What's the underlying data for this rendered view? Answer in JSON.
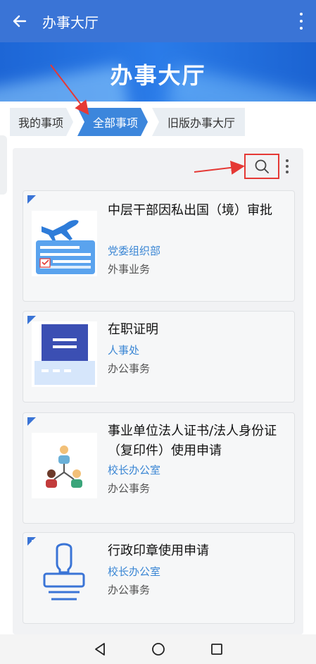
{
  "appbar": {
    "title": "办事大厅",
    "back_icon": "arrow-left-icon",
    "menu_icon": "more-vert-icon"
  },
  "banner": {
    "title": "办事大厅"
  },
  "tabs": [
    {
      "label": "我的事项",
      "active": false
    },
    {
      "label": "全部事项",
      "active": true
    },
    {
      "label": "旧版办事大厅",
      "active": false
    }
  ],
  "toolbar": {
    "search_icon": "search-icon",
    "more_icon": "more-vert-icon",
    "highlight_color": "#e53935"
  },
  "cards": [
    {
      "name": "中层干部因私出国（境）审批",
      "dept": "党委组织部",
      "category": "外事业务",
      "icon": "airplane-form-icon"
    },
    {
      "name": "在职证明",
      "dept": "人事处",
      "category": "办公事务",
      "icon": "document-certificate-icon"
    },
    {
      "name": "事业单位法人证书/法人身份证（复印件）使用申请",
      "dept": "校长办公室",
      "category": "办公事务",
      "icon": "people-network-icon"
    },
    {
      "name": "行政印章使用申请",
      "dept": "校长办公室",
      "category": "办公事务",
      "icon": "stamp-icon"
    }
  ],
  "system_nav": {
    "back": "triangle-back-icon",
    "home": "circle-home-icon",
    "recents": "square-recents-icon"
  },
  "colors": {
    "primary": "#3a74d6",
    "link": "#3a86d4",
    "annotation": "#e53935"
  }
}
